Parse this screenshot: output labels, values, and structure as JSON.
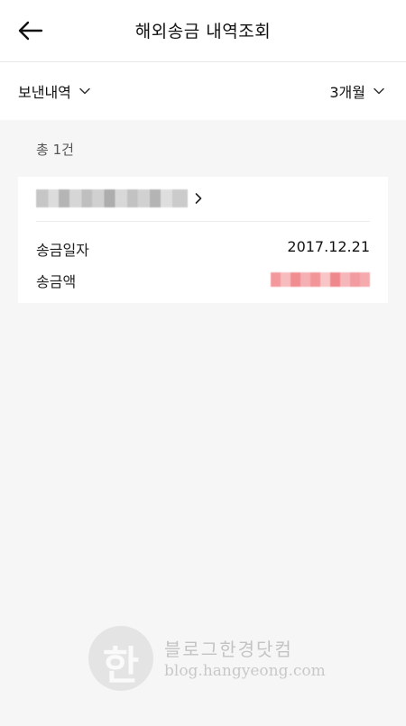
{
  "header": {
    "title": "해외송금 내역조회"
  },
  "filters": {
    "type_label": "보낸내역",
    "period_label": "3개월"
  },
  "summary": {
    "count_text": "총 1건"
  },
  "transfer": {
    "date_label": "송금일자",
    "date_value": "2017.12.21",
    "amount_label": "송금액"
  },
  "watermark": {
    "glyph": "한",
    "line1": "블로그한경닷컴",
    "line2": "blog.hangyeong.com"
  },
  "colors": {
    "background": "#f6f6f6",
    "surface": "#ffffff",
    "text": "#222222"
  }
}
